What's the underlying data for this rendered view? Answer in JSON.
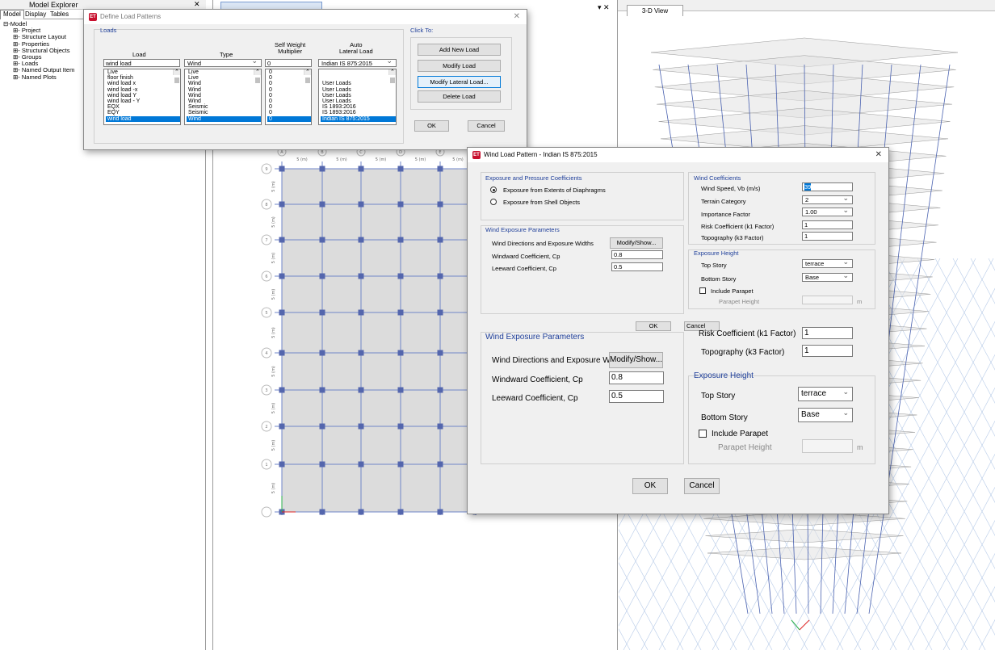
{
  "explorer": {
    "title": "Model Explorer",
    "tabs": [
      "Model",
      "Display",
      "Tables"
    ],
    "tree": [
      "Model",
      "Project",
      "Structure Layout",
      "Properties",
      "Structural Objects",
      "Groups",
      "Loads",
      "Named Output Item",
      "Named Plots"
    ]
  },
  "views": {
    "plan_tab": "Plan View - ...",
    "view3d_tab": "3-D View",
    "close": "▾ ✕"
  },
  "define_load_patterns": {
    "title": "Define Load Patterns",
    "group_title": "Loads",
    "headers": {
      "load": "Load",
      "type": "Type",
      "self_weight": "Self Weight\nMultiplier",
      "auto_lateral": "Auto\nLateral Load"
    },
    "current": {
      "load": "wind load",
      "type": "Wind",
      "multiplier": "0",
      "auto": "Indian IS 875:2015"
    },
    "rows": [
      {
        "load": "Live",
        "type": "Live",
        "mult": "0",
        "auto": ""
      },
      {
        "load": "floor finish",
        "type": "Live",
        "mult": "0",
        "auto": ""
      },
      {
        "load": "wind load x",
        "type": "Wind",
        "mult": "0",
        "auto": "User Loads"
      },
      {
        "load": "wind load -x",
        "type": "Wind",
        "mult": "0",
        "auto": "User Loads"
      },
      {
        "load": "wind load Y",
        "type": "Wind",
        "mult": "0",
        "auto": "User Loads"
      },
      {
        "load": "wind load - Y",
        "type": "Wind",
        "mult": "0",
        "auto": "User Loads"
      },
      {
        "load": "EQX",
        "type": "Seismic",
        "mult": "0",
        "auto": "IS 1893:2016"
      },
      {
        "load": "EQY",
        "type": "Seismic",
        "mult": "0",
        "auto": "IS 1893:2016"
      },
      {
        "load": "wind load",
        "type": "Wind",
        "mult": "0",
        "auto": "Indian IS 875:2015"
      }
    ],
    "click_to": "Click To:",
    "buttons": {
      "add": "Add New Load",
      "modify": "Modify Load",
      "modify_lateral": "Modify Lateral Load...",
      "delete": "Delete Load",
      "ok": "OK",
      "cancel": "Cancel"
    }
  },
  "wind_dialog": {
    "title": "Wind Load Pattern - Indian IS 875:2015",
    "exposure_group": "Exposure and Pressure Coefficients",
    "radio1": "Exposure from Extents of Diaphragms",
    "radio2": "Exposure from Shell Objects",
    "params_group": "Wind Exposure Parameters",
    "directions_label": "Wind Directions and Exposure Widths",
    "modify_show": "Modify/Show...",
    "windward_label": "Windward Coefficient, Cp",
    "windward_value": "0.8",
    "leeward_label": "Leeward Coefficient, Cp",
    "leeward_value": "0.5",
    "coeff_group": "Wind Coefficients",
    "speed_label": "Wind Speed, Vb (m/s)",
    "speed_value": "39",
    "terrain_label": "Terrain Category",
    "terrain_value": "2",
    "importance_label": "Importance Factor",
    "importance_value": "1.00",
    "risk_label": "Risk Coefficient (k1 Factor)",
    "risk_value": "1",
    "topo_label": "Topography (k3 Factor)",
    "topo_value": "1",
    "height_group": "Exposure Height",
    "top_story_label": "Top Story",
    "top_story_value": "terrace",
    "bottom_story_label": "Bottom Story",
    "bottom_story_value": "Base",
    "parapet_label": "Include Parapet",
    "parapet_height_label": "Parapet Height",
    "unit": "m",
    "ok": "OK",
    "cancel": "Cancel"
  },
  "zoom_panel": {
    "params_group": "Wind Exposure Parameters",
    "directions_label": "Wind Directions and Exposure Widths",
    "modify_show": "Modify/Show...",
    "windward_label": "Windward Coefficient, Cp",
    "windward_value": "0.8",
    "leeward_label": "Leeward Coefficient, Cp",
    "leeward_value": "0.5",
    "risk_label": "Risk Coefficient (k1 Factor)",
    "risk_value": "1",
    "topo_label": "Topography (k3 Factor)",
    "topo_value": "1",
    "height_group": "Exposure Height",
    "top_story_label": "Top Story",
    "top_story_value": "terrace",
    "bottom_story_label": "Bottom Story",
    "bottom_story_value": "Base",
    "parapet_label": "Include Parapet",
    "parapet_height_label": "Parapet Height",
    "unit": "m",
    "ok": "OK",
    "cancel": "Cancel"
  },
  "grid": {
    "col_labels": [
      "A",
      "B",
      "C",
      "D",
      "E",
      "F"
    ],
    "row_labels": [
      "9",
      "8",
      "7",
      "6",
      "5",
      "4",
      "3",
      "2",
      "1"
    ],
    "spacing_label": "5 (m)"
  },
  "colors": {
    "accent": "#0078d7",
    "group_title": "#1f3f9a",
    "grid_line": "#6f86c9",
    "column": "#5466ad"
  }
}
